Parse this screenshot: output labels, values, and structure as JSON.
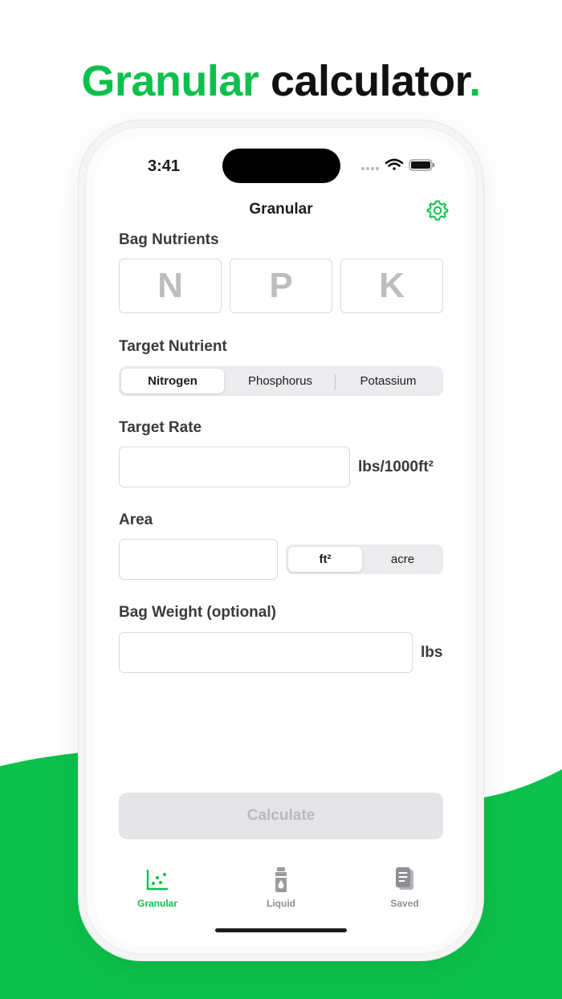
{
  "hero": {
    "word1": "Granular",
    "word2": "calculator",
    "period": "."
  },
  "colors": {
    "accent": "#0cc14b",
    "text": "#1c1c1e",
    "disabled_button_bg": "#e5e5e7"
  },
  "status_bar": {
    "time": "3:41",
    "icons": [
      "signal-icon",
      "wifi-icon",
      "battery-icon"
    ]
  },
  "nav": {
    "title": "Granular",
    "settings_icon": "gear-icon"
  },
  "bag_nutrients": {
    "label": "Bag Nutrients",
    "boxes": [
      {
        "placeholder": "N",
        "value": ""
      },
      {
        "placeholder": "P",
        "value": ""
      },
      {
        "placeholder": "K",
        "value": ""
      }
    ]
  },
  "target_nutrient": {
    "label": "Target Nutrient",
    "options": [
      "Nitrogen",
      "Phosphorus",
      "Potassium"
    ],
    "selected": "Nitrogen"
  },
  "target_rate": {
    "label": "Target Rate",
    "value": "",
    "unit": "lbs/1000ft²"
  },
  "area": {
    "label": "Area",
    "value": "",
    "units": [
      "ft²",
      "acre"
    ],
    "selected_unit": "ft²"
  },
  "bag_weight": {
    "label": "Bag Weight (optional)",
    "value": "",
    "unit": "lbs"
  },
  "calculate_button": {
    "label": "Calculate",
    "enabled": false
  },
  "tab_bar": {
    "items": [
      {
        "label": "Granular",
        "icon": "scatter-chart-icon",
        "active": true
      },
      {
        "label": "Liquid",
        "icon": "bottle-icon",
        "active": false
      },
      {
        "label": "Saved",
        "icon": "documents-icon",
        "active": false
      }
    ]
  }
}
